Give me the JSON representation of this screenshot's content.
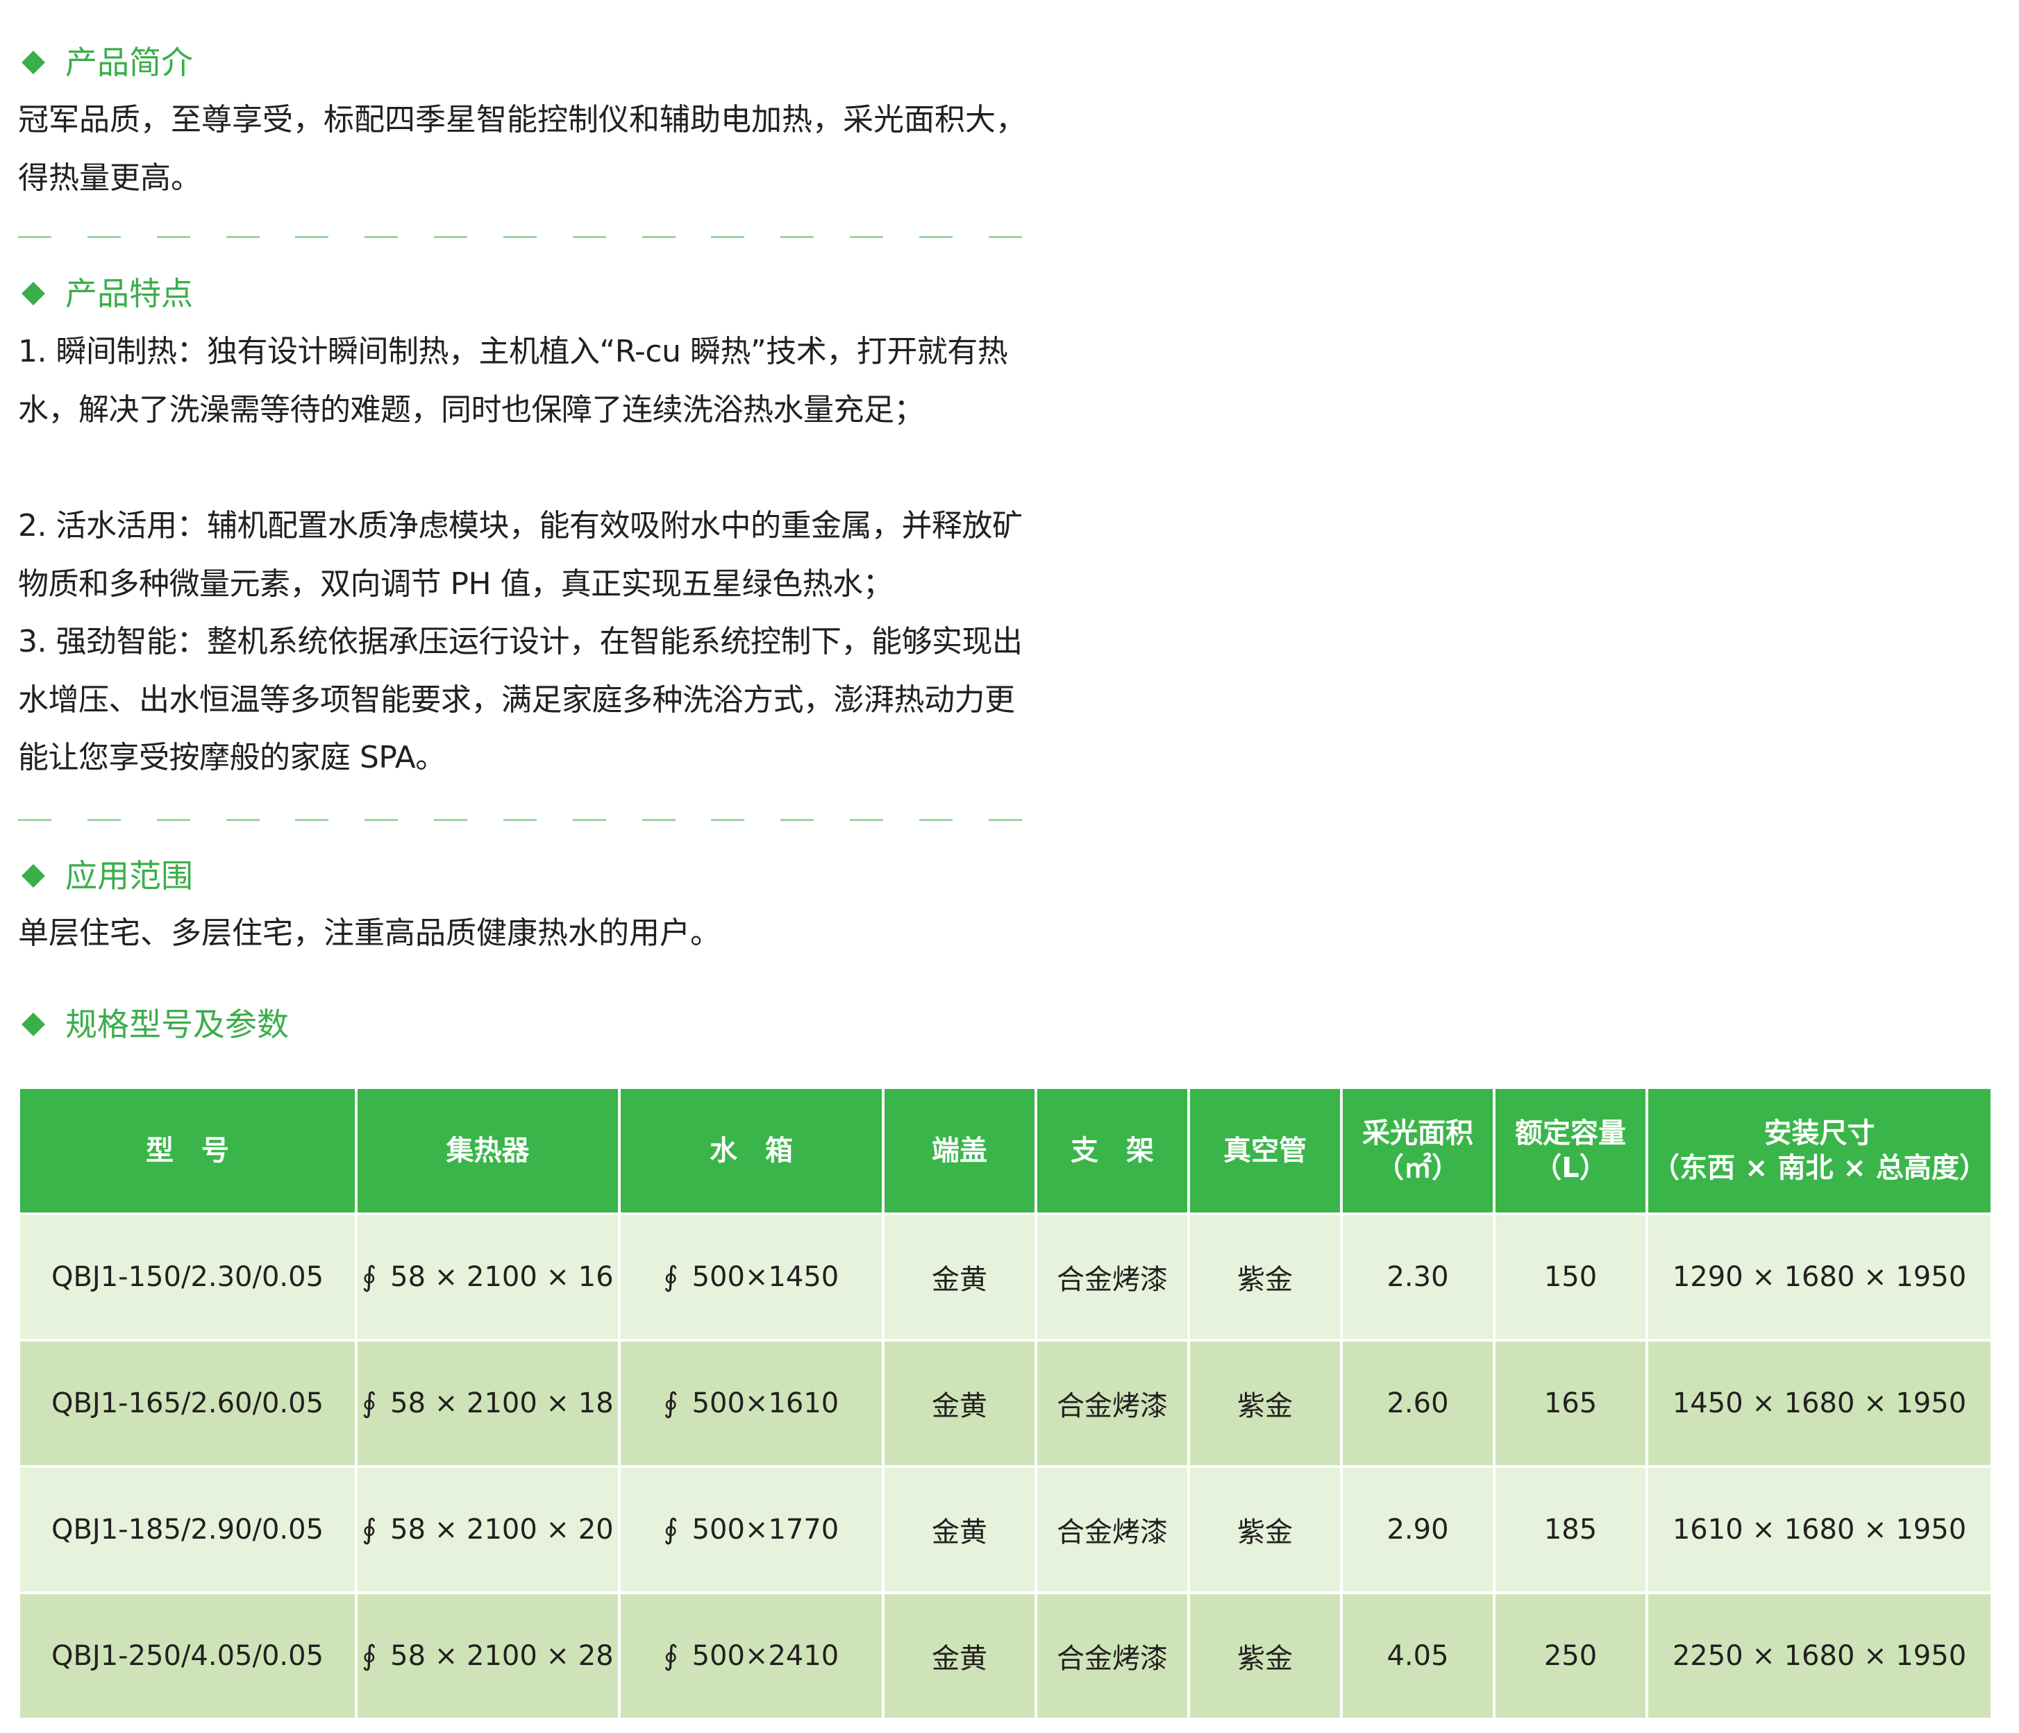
{
  "intro": {
    "title": "产品简介",
    "text": "冠军品质，至尊享受，标配四季星智能控制仪和辅助电加热，采光面积大，\n得热量更高。"
  },
  "features": {
    "title": "产品特点",
    "items": [
      "1. 瞬间制热：独有设计瞬间制热，主机植入“R-cu 瞬热”技术，打开就有热水，解决了洗澡需等待的难题，同时也保障了连续洗浴热水量充足；",
      "2. 活水活用：辅机配置水质净虑模块，能有效吸附水中的重金属，并释放矿物质和多种微量元素，双向调节 PH 值，真正实现五星绿色热水；",
      "3. 强劲智能：整机系统依据承压运行设计，在智能系统控制下，能够实现出水增压、出水恒温等多项智能要求，满足家庭多种洗浴方式，澎湃热动力更能让您享受按摩般的家庭 SPA。"
    ]
  },
  "scope": {
    "title": "应用范围",
    "text": "单层住宅、多层住宅，注重高品质健康热水的用户。"
  },
  "specs": {
    "title": "规格型号及参数",
    "headers": {
      "model": "型　号",
      "collector": "集热器",
      "tank": "水　箱",
      "endcap": "端盖",
      "stand": "支　架",
      "tube": "真空管",
      "area_l1": "采光面积",
      "area_l2": "（㎡）",
      "cap_l1": "额定容量",
      "cap_l2": "（L）",
      "size_l1": "安装尺寸",
      "size_l2": "（东西 × 南北 × 总高度）"
    },
    "pipe_symbol": "∮",
    "rows": [
      {
        "model": "QBJ1-150/2.30/0.05",
        "collector": "58 × 2100 × 16",
        "tank": "500×1450",
        "endcap": "金黄",
        "stand": "合金烤漆",
        "tube": "紫金",
        "area": "2.30",
        "capacity": "150",
        "size": "1290 × 1680 × 1950"
      },
      {
        "model": "QBJ1-165/2.60/0.05",
        "collector": "58 × 2100 × 18",
        "tank": "500×1610",
        "endcap": "金黄",
        "stand": "合金烤漆",
        "tube": "紫金",
        "area": "2.60",
        "capacity": "165",
        "size": "1450 × 1680 × 1950"
      },
      {
        "model": "QBJ1-185/2.90/0.05",
        "collector": "58 × 2100 × 20",
        "tank": "500×1770",
        "endcap": "金黄",
        "stand": "合金烤漆",
        "tube": "紫金",
        "area": "2.90",
        "capacity": "185",
        "size": "1610 × 1680 × 1950"
      },
      {
        "model": "QBJ1-250/4.05/0.05",
        "collector": "58 × 2100 × 28",
        "tank": "500×2410",
        "endcap": "金黄",
        "stand": "合金烤漆",
        "tube": "紫金",
        "area": "4.05",
        "capacity": "250",
        "size": "2250 × 1680 × 1950"
      }
    ]
  },
  "colors": {
    "accent": "#3aae4a",
    "header_bg": "#3ab54a",
    "row_light": "#e6f2db",
    "row_dark": "#cee4b8",
    "divider": "#9fd3a6"
  }
}
